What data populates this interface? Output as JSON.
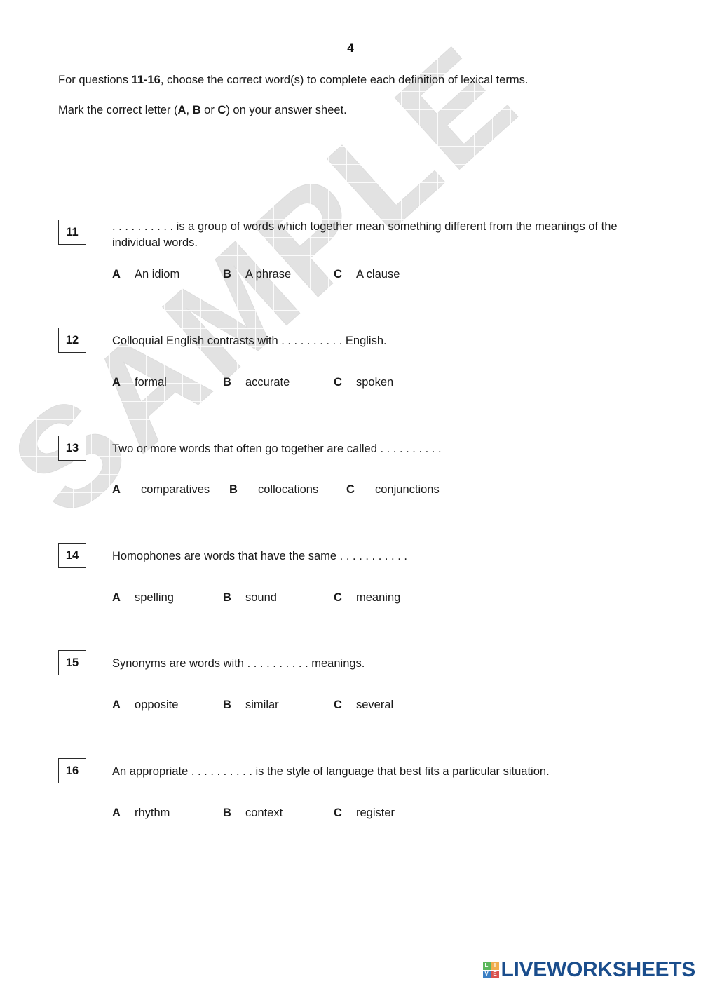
{
  "page": {
    "number": "4"
  },
  "instructions": {
    "line1_prefix": "For questions ",
    "line1_bold": "11-16",
    "line1_suffix": ", choose the correct word(s) to complete each definition of lexical terms.",
    "line2_prefix": "Mark the correct letter (",
    "line2_a": "A",
    "line2_sep1": ", ",
    "line2_b": "B",
    "line2_sep2": " or ",
    "line2_c": "C",
    "line2_suffix": ") on your answer sheet."
  },
  "questions": [
    {
      "number": "11",
      "stem": ". . . . . . . . . . is a group of words which together mean something different from the meanings of the individual words.",
      "options": [
        {
          "letter": "A",
          "text": "An idiom"
        },
        {
          "letter": "B",
          "text": "A phrase"
        },
        {
          "letter": "C",
          "text": "A clause"
        }
      ]
    },
    {
      "number": "12",
      "stem": "Colloquial English contrasts with . . . . . . . . . . English.",
      "options": [
        {
          "letter": "A",
          "text": "formal"
        },
        {
          "letter": "B",
          "text": "accurate"
        },
        {
          "letter": "C",
          "text": "spoken"
        }
      ]
    },
    {
      "number": "13",
      "stem": "Two or more words that often go together are called . . . . . . . . . .",
      "options": [
        {
          "letter": "A",
          "text": "comparatives"
        },
        {
          "letter": "B",
          "text": "collocations"
        },
        {
          "letter": "C",
          "text": "conjunctions"
        }
      ]
    },
    {
      "number": "14",
      "stem": "Homophones are words that have the same . . . . . . . . . . .",
      "options": [
        {
          "letter": "A",
          "text": "spelling"
        },
        {
          "letter": "B",
          "text": "sound"
        },
        {
          "letter": "C",
          "text": "meaning"
        }
      ]
    },
    {
      "number": "15",
      "stem": "Synonyms are words with . . . . . . . . . . meanings.",
      "options": [
        {
          "letter": "A",
          "text": "opposite"
        },
        {
          "letter": "B",
          "text": "similar"
        },
        {
          "letter": "C",
          "text": "several"
        }
      ]
    },
    {
      "number": "16",
      "stem": "An appropriate . . . . . . . . . . is the style of language that best fits a particular situation.",
      "options": [
        {
          "letter": "A",
          "text": "rhythm"
        },
        {
          "letter": "B",
          "text": "context"
        },
        {
          "letter": "C",
          "text": "register"
        }
      ]
    }
  ],
  "watermark": {
    "text": "SAMPLE",
    "color": "#e2e2e2"
  },
  "logo": {
    "mark_letters": [
      "L",
      "I",
      "V",
      "E"
    ],
    "wordmark": "LIVEWORKSHEETS",
    "color": "#1a4d8c",
    "mark_colors": [
      "#5cb85c",
      "#f0ad4e",
      "#3b7fc4",
      "#d9534f"
    ]
  }
}
